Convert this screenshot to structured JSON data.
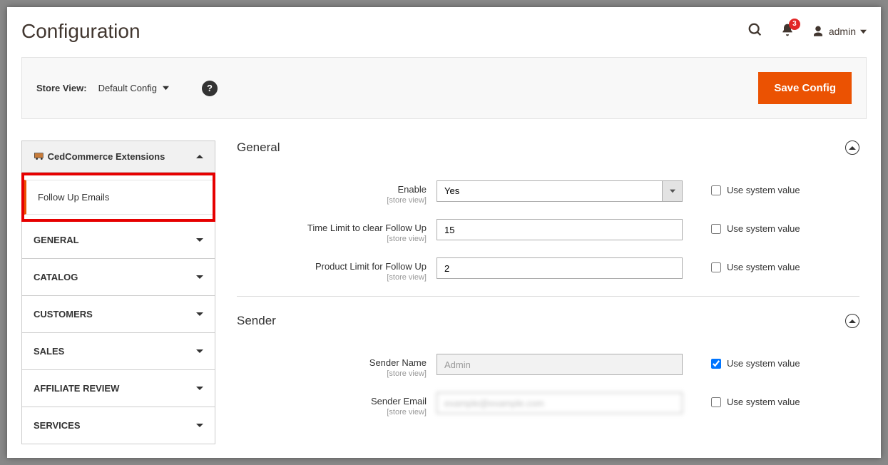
{
  "header": {
    "title": "Configuration",
    "notifications_count": "3",
    "admin_label": "admin"
  },
  "storebar": {
    "label": "Store View:",
    "selected": "Default Config",
    "save_label": "Save Config"
  },
  "sidebar": {
    "extensions_header": "CedCommerce Extensions",
    "active_item": "Follow Up Emails",
    "items": [
      {
        "label": "GENERAL"
      },
      {
        "label": "CATALOG"
      },
      {
        "label": "CUSTOMERS"
      },
      {
        "label": "SALES"
      },
      {
        "label": "AFFILIATE REVIEW"
      },
      {
        "label": "SERVICES"
      }
    ]
  },
  "scope_text": "[store view]",
  "use_system_label": "Use system value",
  "sections": {
    "general": {
      "title": "General",
      "fields": {
        "enable": {
          "label": "Enable",
          "value": "Yes",
          "use_system": false
        },
        "time_limit": {
          "label": "Time Limit to clear Follow Up",
          "value": "15",
          "use_system": false
        },
        "product_limit": {
          "label": "Product Limit for Follow Up",
          "value": "2",
          "use_system": false
        }
      }
    },
    "sender": {
      "title": "Sender",
      "fields": {
        "sender_name": {
          "label": "Sender Name",
          "value": "Admin",
          "use_system": true
        },
        "sender_email": {
          "label": "Sender Email",
          "value": "example@example.com",
          "use_system": false
        }
      }
    }
  }
}
